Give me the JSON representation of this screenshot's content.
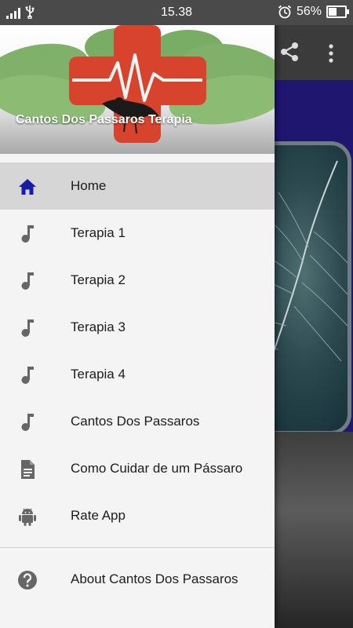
{
  "status_bar": {
    "time": "15.38",
    "battery": "56%",
    "battery_fraction": 0.56
  },
  "drawer": {
    "header_title": "Cantos Dos Passaros Terapia",
    "items": [
      {
        "label": "Home",
        "icon": "home-icon",
        "active": true
      },
      {
        "label": "Terapia 1",
        "icon": "music-note-icon"
      },
      {
        "label": "Terapia 2",
        "icon": "music-note-icon"
      },
      {
        "label": "Terapia 3",
        "icon": "music-note-icon"
      },
      {
        "label": "Terapia 4",
        "icon": "music-note-icon"
      },
      {
        "label": "Cantos Dos Passaros",
        "icon": "music-note-icon"
      },
      {
        "label": "Como Cuidar de um Pássaro",
        "icon": "document-icon"
      },
      {
        "label": "Rate App",
        "icon": "android-icon"
      }
    ],
    "footer_items": [
      {
        "label": "About Cantos Dos Passaros",
        "icon": "help-icon"
      }
    ]
  },
  "background_app": {
    "toolbar_icons": [
      "share-icon",
      "more-vert-icon"
    ]
  },
  "colors": {
    "status_bar": "#4a4a4a",
    "drawer_bg": "#f4f4f4",
    "active_item_bg": "#d6d6d6",
    "home_icon": "#1a1aa8",
    "menu_icon": "#666666",
    "panel_bg": "#1f1670"
  }
}
